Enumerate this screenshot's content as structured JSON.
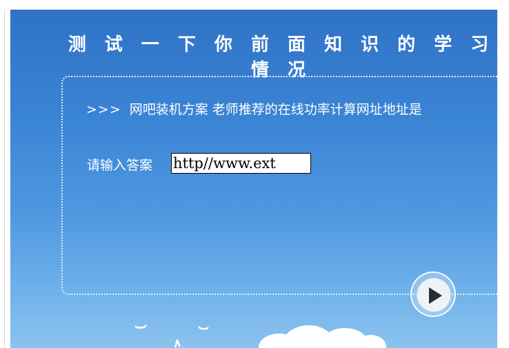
{
  "page": {
    "title": "测 试 一 下 你 前 面 知 识 的 学 习 情 况"
  },
  "question": {
    "prefix": ">>>",
    "text": "网吧装机方案 老师推荐的在线功率计算网址地址是"
  },
  "answer": {
    "label": "请输入答案",
    "value": "http//www.ext"
  },
  "controls": {
    "play_icon": "play-icon"
  },
  "colors": {
    "sky_top": "#2f72c6",
    "sky_bottom": "#8cc3ef",
    "text": "#ffffff"
  }
}
